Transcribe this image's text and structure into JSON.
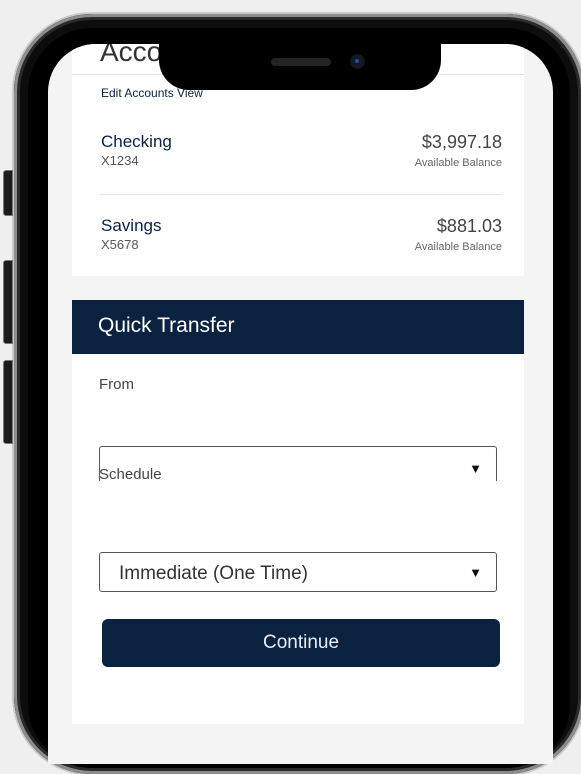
{
  "accounts": {
    "title": "Acco",
    "edit_link": "Edit Accounts View",
    "items": [
      {
        "name": "Checking",
        "number": "X1234",
        "balance": "$3,997.18",
        "balance_label": "Available Balance"
      },
      {
        "name": "Savings",
        "number": "X5678",
        "balance": "$881.03",
        "balance_label": "Available Balance"
      }
    ]
  },
  "quick_transfer": {
    "title": "Quick Transfer",
    "from_label": "From",
    "from_value": "",
    "schedule_label": "Schedule",
    "schedule_value": "Immediate (One Time)",
    "dropdown_arrow": "▼",
    "continue_label": "Continue"
  },
  "colors": {
    "navy": "#0a2240",
    "background": "#f4f4f4"
  }
}
